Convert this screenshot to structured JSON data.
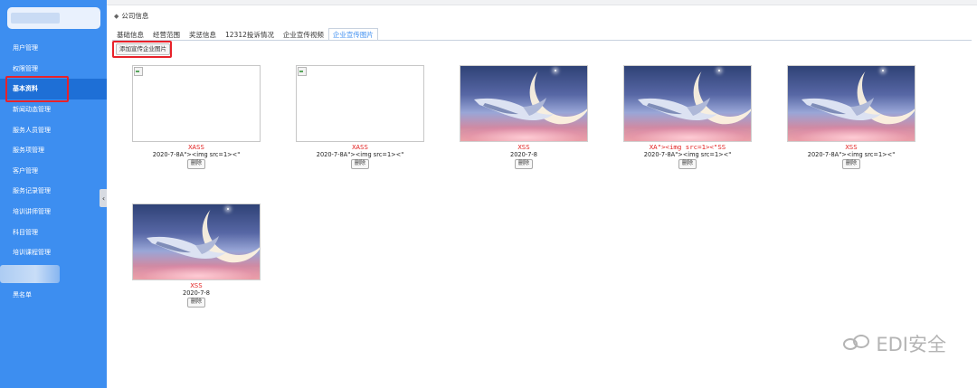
{
  "sidebar": {
    "items": [
      {
        "label": "用户管理",
        "active": false
      },
      {
        "label": "权限管理",
        "active": false
      },
      {
        "label": "基本资料",
        "active": true
      },
      {
        "label": "新闻动态管理",
        "active": false
      },
      {
        "label": "服务人员管理",
        "active": false
      },
      {
        "label": "服务项管理",
        "active": false
      },
      {
        "label": "客户管理",
        "active": false
      },
      {
        "label": "服务记录管理",
        "active": false
      },
      {
        "label": "培训讲师管理",
        "active": false
      },
      {
        "label": "科目管理",
        "active": false
      },
      {
        "label": "培训课程管理",
        "active": false
      }
    ],
    "bottom_item": "黑名单",
    "collapse_icon": "‹"
  },
  "breadcrumb": {
    "icon": "◆",
    "label": "公司信息"
  },
  "tabs": [
    {
      "label": "基础信息",
      "active": false
    },
    {
      "label": "经营范围",
      "active": false
    },
    {
      "label": "奖惩信息",
      "active": false
    },
    {
      "label": "12312投诉情况",
      "active": false
    },
    {
      "label": "企业宣传视频",
      "active": false
    },
    {
      "label": "企业宣传图片",
      "active": true
    }
  ],
  "toolbar": {
    "add_label": "添加宣传企业图片"
  },
  "cards": [
    {
      "title": "XASS",
      "date": "2020-7-8A\"><img src=1><\"",
      "delete_label": "删除",
      "image_kind": "broken"
    },
    {
      "title": "XASS",
      "date": "2020-7-8A\"><img src=1><\"",
      "delete_label": "删除",
      "image_kind": "broken"
    },
    {
      "title": "XSS",
      "date": "2020-7-8",
      "delete_label": "删除",
      "image_kind": "photo"
    },
    {
      "title": "XA\"><img src=1><\"SS",
      "date": "2020-7-8A\"><img src=1><\"",
      "delete_label": "删除",
      "image_kind": "photo"
    },
    {
      "title": "XSS",
      "date": "2020-7-8A\"><img src=1><\"",
      "delete_label": "删除",
      "image_kind": "photo"
    },
    {
      "title": "XSS",
      "date": "2020-7-8",
      "delete_label": "删除",
      "image_kind": "photo"
    }
  ],
  "watermark": {
    "text": "EDI安全"
  },
  "colors": {
    "sidebar": "#3d8ef0",
    "active_menu": "#1e6fd6",
    "highlight_red": "#e8222a",
    "caption_red": "#e21f1f",
    "active_tab": "#3d8ef0"
  }
}
